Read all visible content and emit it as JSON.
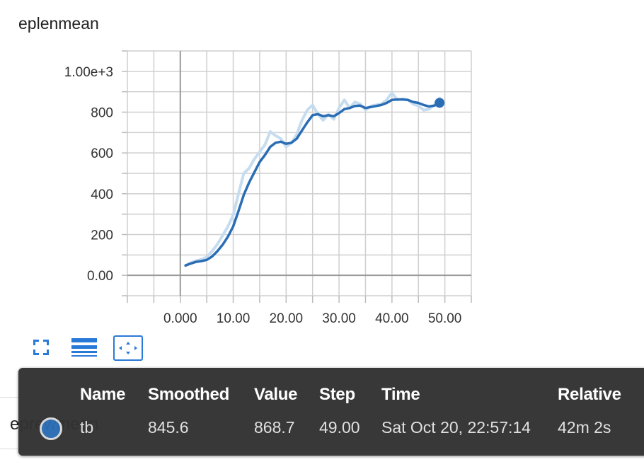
{
  "card": {
    "title": "eplenmean"
  },
  "toolbar": {
    "buttons": [
      {
        "name": "expand-chart",
        "icon": "fullscreen-icon"
      },
      {
        "name": "toggle-log-scale",
        "icon": "lines-icon"
      },
      {
        "name": "fit-domain",
        "icon": "fit-to-data-icon",
        "active": true
      }
    ],
    "accent": "#2979d8"
  },
  "background_card": {
    "title": "eprewmean"
  },
  "tooltip": {
    "headers": {
      "name": "Name",
      "smoothed": "Smoothed",
      "value": "Value",
      "step": "Step",
      "time": "Time",
      "relative": "Relative"
    },
    "row": {
      "name": "tb",
      "smoothed": "845.6",
      "value": "868.7",
      "step": "49.00",
      "time": "Sat Oct 20, 22:57:14",
      "relative": "42m 2s",
      "color": "#2a6db4"
    }
  },
  "chart_data": {
    "type": "line",
    "title": "eplenmean",
    "xlabel": "",
    "ylabel": "",
    "xlim": [
      -10,
      55
    ],
    "ylim": [
      -100,
      1100
    ],
    "grid": true,
    "x_ticks": [
      0,
      10,
      20,
      30,
      40,
      50
    ],
    "x_tick_labels": [
      "0.000",
      "10.00",
      "20.00",
      "30.00",
      "40.00",
      "50.00"
    ],
    "y_ticks": [
      0,
      200,
      400,
      600,
      800,
      1000
    ],
    "y_tick_labels": [
      "0.00",
      "200",
      "400",
      "600",
      "800",
      "1.00e+3"
    ],
    "series": [
      {
        "name": "tb (raw)",
        "color": "#c6dcef",
        "x": [
          1,
          2,
          3,
          4,
          5,
          6,
          7,
          8,
          9,
          10,
          11,
          12,
          13,
          14,
          15,
          16,
          17,
          18,
          19,
          20,
          21,
          22,
          23,
          24,
          25,
          26,
          27,
          28,
          29,
          30,
          31,
          32,
          33,
          34,
          35,
          36,
          37,
          38,
          39,
          40,
          41,
          42,
          43,
          44,
          45,
          46,
          47,
          48,
          49
        ],
        "values": [
          48,
          62,
          72,
          78,
          90,
          118,
          152,
          195,
          240,
          295,
          400,
          500,
          525,
          570,
          605,
          640,
          705,
          685,
          670,
          630,
          650,
          690,
          760,
          810,
          835,
          790,
          760,
          790,
          765,
          820,
          860,
          820,
          850,
          840,
          810,
          830,
          835,
          840,
          860,
          895,
          860,
          865,
          860,
          840,
          830,
          810,
          815,
          835,
          868.7
        ]
      },
      {
        "name": "tb (smoothed)",
        "color": "#2a6db4",
        "x": [
          1,
          2,
          3,
          4,
          5,
          6,
          7,
          8,
          9,
          10,
          11,
          12,
          13,
          14,
          15,
          16,
          17,
          18,
          19,
          20,
          21,
          22,
          23,
          24,
          25,
          26,
          27,
          28,
          29,
          30,
          31,
          32,
          33,
          34,
          35,
          36,
          37,
          38,
          39,
          40,
          41,
          42,
          43,
          44,
          45,
          46,
          47,
          48,
          49
        ],
        "values": [
          48,
          58,
          66,
          70,
          76,
          92,
          118,
          150,
          190,
          240,
          315,
          395,
          455,
          505,
          555,
          590,
          630,
          650,
          655,
          645,
          650,
          670,
          710,
          750,
          785,
          790,
          780,
          785,
          780,
          795,
          815,
          820,
          830,
          832,
          820,
          825,
          830,
          835,
          845,
          860,
          862,
          862,
          860,
          850,
          845,
          835,
          828,
          832,
          845.6
        ]
      }
    ],
    "highlight_point": {
      "x": 49,
      "y": 845.6
    }
  }
}
